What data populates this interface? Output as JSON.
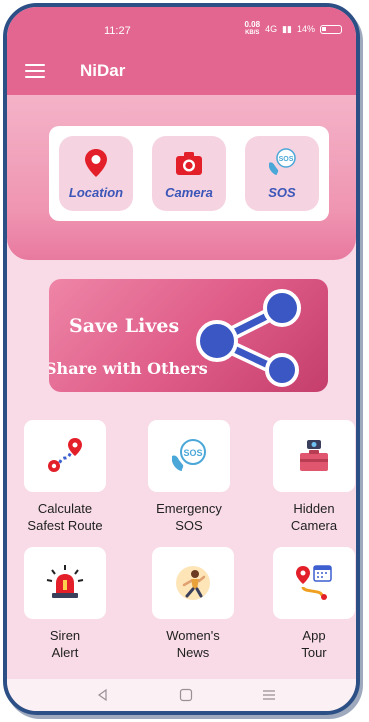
{
  "status": {
    "time": "11:27",
    "speed_value": "0.08",
    "speed_unit": "KB/S",
    "network": "4G",
    "battery": "14%"
  },
  "appbar": {
    "title": "NiDar"
  },
  "quick_actions": [
    {
      "label": "Location",
      "icon": "location-pin-icon"
    },
    {
      "label": "Camera",
      "icon": "camera-icon"
    },
    {
      "label": "SOS",
      "icon": "sos-phone-icon"
    }
  ],
  "banner": {
    "title": "Save Lives",
    "subtitle": "Share with Others",
    "icon": "share-icon"
  },
  "features": [
    {
      "line1": "Calculate",
      "line2": "Safest Route",
      "icon": "route-icon"
    },
    {
      "line1": "Emergency",
      "line2": "SOS",
      "icon": "sos-phone-icon"
    },
    {
      "line1": "Hidden",
      "line2": "Camera",
      "icon": "hidden-camera-icon"
    },
    {
      "line1": "Siren",
      "line2": "Alert",
      "icon": "siren-icon"
    },
    {
      "line1": "Women's",
      "line2": "News",
      "icon": "news-icon"
    },
    {
      "line1": "App",
      "line2": "Tour",
      "icon": "map-tour-icon"
    }
  ],
  "colors": {
    "primary": "#e26690",
    "accent": "#3b56b8",
    "frame": "#2c4f85"
  }
}
